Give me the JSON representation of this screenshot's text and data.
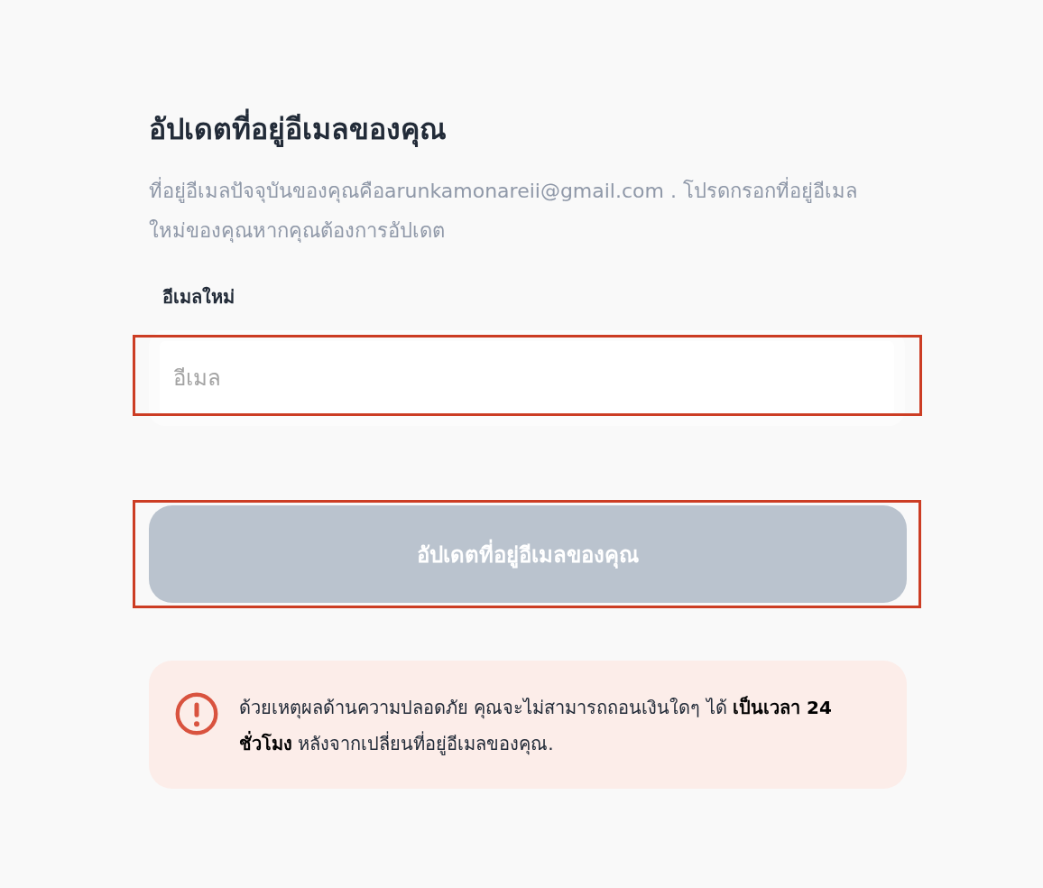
{
  "title": "อัปเดตที่อยู่อีเมลของคุณ",
  "description": "ที่อยู่อีเมลปัจจุบันของคุณคือarunkamonareii@gmail.com . โปรดกรอกที่อยู่อีเมล ใหม่ของคุณหากคุณต้องการอัปเดต",
  "email_field": {
    "label": "อีเมลใหม่",
    "placeholder": "อีเมล"
  },
  "submit_button": {
    "label": "อัปเดตที่อยู่อีเมลของคุณ",
    "disabled": true
  },
  "alert": {
    "text": "ด้วยเหตุผลด้านความปลอดภัย คุณจะไม่สามารถถอนเงินใดๆ ได้ **เป็นเวลา 24 ชั่วโมง** หลังจากเปลี่ยนที่อยู่อีเมลของคุณ."
  }
}
